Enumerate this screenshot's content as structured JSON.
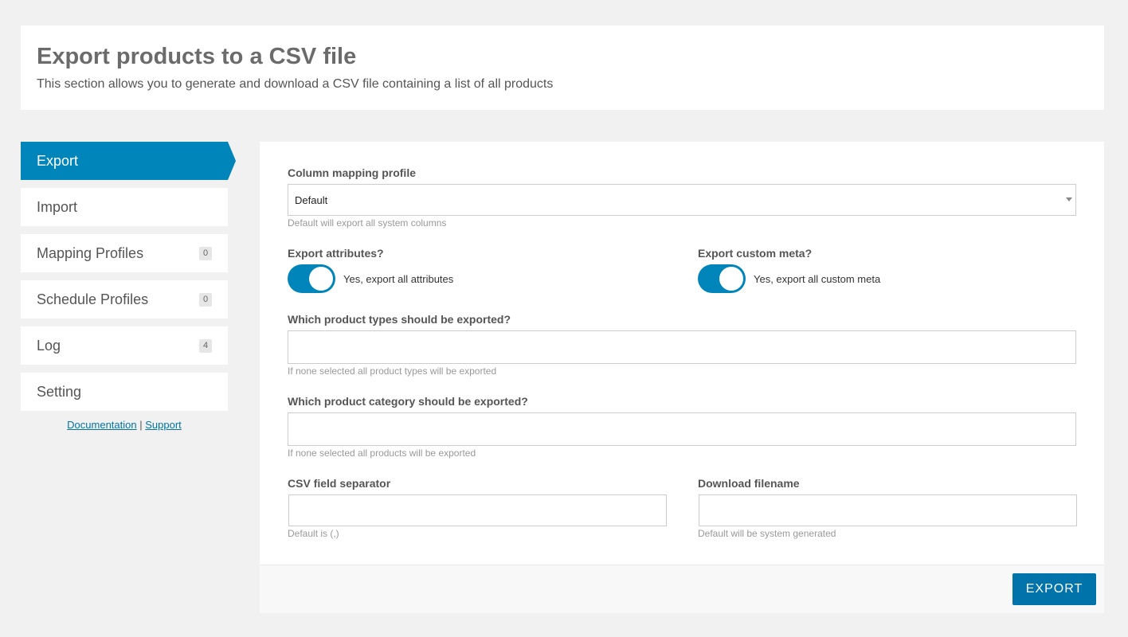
{
  "header": {
    "title": "Export products to a CSV file",
    "subtitle": "This section allows you to generate and download a CSV file containing a list of all products"
  },
  "sidebar": {
    "items": [
      {
        "label": "Export",
        "active": true
      },
      {
        "label": "Import"
      },
      {
        "label": "Mapping Profiles",
        "badge": "0"
      },
      {
        "label": "Schedule Profiles",
        "badge": "0"
      },
      {
        "label": "Log",
        "badge": "4"
      },
      {
        "label": "Setting"
      }
    ],
    "links": {
      "documentation": "Documentation",
      "separator": "|",
      "support": "Support"
    }
  },
  "form": {
    "mapping": {
      "label": "Column mapping profile",
      "value": "Default",
      "hint": "Default will export all system columns"
    },
    "attributes": {
      "label": "Export attributes?",
      "toggle_text": "Yes, export all attributes",
      "enabled": true
    },
    "custom_meta": {
      "label": "Export custom meta?",
      "toggle_text": "Yes, export all custom meta",
      "enabled": true
    },
    "product_types": {
      "label": "Which product types should be exported?",
      "value": "",
      "hint": "If none selected all product types will be exported"
    },
    "product_category": {
      "label": "Which product category should be exported?",
      "value": "",
      "hint": "If none selected all products will be exported"
    },
    "separator": {
      "label": "CSV field separator",
      "value": "",
      "hint": "Default is (,)"
    },
    "filename": {
      "label": "Download filename",
      "value": "",
      "hint": "Default will be system generated"
    },
    "export_label": "EXPORT"
  },
  "colors": {
    "accent": "#0085ba",
    "button": "#0073aa",
    "background": "#f1f1f1"
  }
}
